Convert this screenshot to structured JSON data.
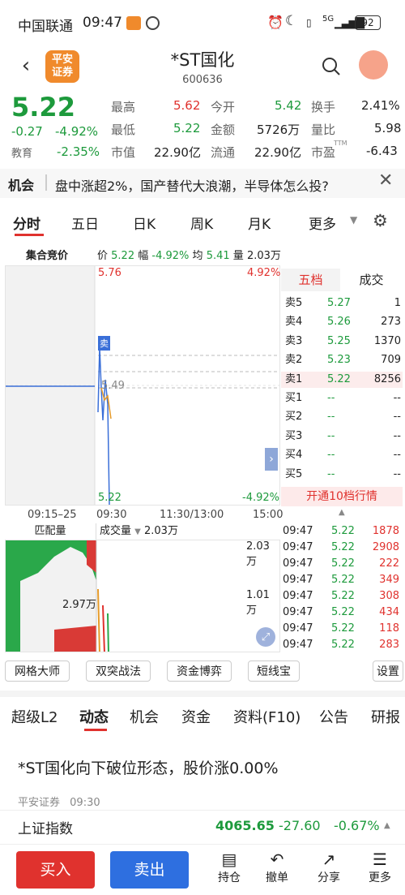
{
  "status": {
    "carrier": "中国联通",
    "time": "09:47",
    "signal": "5G",
    "battery": "92"
  },
  "nav": {
    "broker_line1": "平安",
    "broker_line2": "证券",
    "title": "*ST国化",
    "code": "600636"
  },
  "quote": {
    "price": "5.22",
    "change": "-0.27",
    "pct": "-4.92%",
    "sector": "教育",
    "sector_pct": "-2.35%",
    "high_l": "最高",
    "high": "5.62",
    "open_l": "今开",
    "open": "5.42",
    "turn_l": "换手",
    "turn": "2.41%",
    "low_l": "最低",
    "low": "5.22",
    "amt_l": "金额",
    "amt": "5726万",
    "vr_l": "量比",
    "vr": "5.98",
    "mcap_l": "市值",
    "mcap": "22.90亿",
    "float_l": "流通",
    "float": "22.90亿",
    "pe_l": "市盈",
    "pe_sup": "TTM",
    "pe": "-6.43"
  },
  "news": {
    "tag": "机会",
    "text": "盘中涨超2%，国产替代大浪潮，半导体怎么投?"
  },
  "tabs1": [
    "分时",
    "五日",
    "日K",
    "周K",
    "月K",
    "更多"
  ],
  "auction": {
    "label": "集合竞价",
    "price_l": "价",
    "price": "5.22",
    "range_l": "幅",
    "range": "-4.92%",
    "avg_l": "均",
    "avg": "5.41",
    "vol_l": "量",
    "vol": "2.03万"
  },
  "chart": {
    "top_price": "5.76",
    "top_pct": "4.92%",
    "mid": "5.49",
    "bot_price": "5.22",
    "bot_pct": "-4.92%",
    "sell_marker": "卖",
    "times": [
      "09:15–25",
      "09:30",
      "11:30/13:00",
      "15:00"
    ],
    "vol_tab_left": "匹配量",
    "vol_tab_right": "成交量",
    "vol_value": "2.03万",
    "vol_top": "2.03万",
    "vol_mid": "1.01万",
    "match_mid": "2.97万"
  },
  "order": {
    "tab_left": "五档",
    "tab_right": "成交",
    "levels": [
      [
        "卖5",
        "5.27",
        "1"
      ],
      [
        "卖4",
        "5.26",
        "273"
      ],
      [
        "卖3",
        "5.25",
        "1370"
      ],
      [
        "卖2",
        "5.23",
        "709"
      ],
      [
        "卖1",
        "5.22",
        "8256"
      ],
      [
        "买1",
        "--",
        "--"
      ],
      [
        "买2",
        "--",
        "--"
      ],
      [
        "买3",
        "--",
        "--"
      ],
      [
        "买4",
        "--",
        "--"
      ],
      [
        "买5",
        "--",
        "--"
      ]
    ],
    "open10": "开通10档行情"
  },
  "trades": [
    [
      "09:47",
      "5.22",
      "1878"
    ],
    [
      "09:47",
      "5.22",
      "2908"
    ],
    [
      "09:47",
      "5.22",
      "222"
    ],
    [
      "09:47",
      "5.22",
      "349"
    ],
    [
      "09:47",
      "5.22",
      "308"
    ],
    [
      "09:47",
      "5.22",
      "434"
    ],
    [
      "09:47",
      "5.22",
      "118"
    ],
    [
      "09:47",
      "5.22",
      "283"
    ]
  ],
  "tools": [
    "网格大师",
    "双突战法",
    "资金博弈",
    "短线宝",
    "设置"
  ],
  "tabs2": [
    "超级L2",
    "动态",
    "机会",
    "资金",
    "资料(F10)",
    "公告",
    "研报"
  ],
  "article": {
    "title": "*ST国化向下破位形态，股价涨0.00%",
    "source": "平安证券",
    "time": "09:30"
  },
  "index": {
    "name": "上证指数",
    "value": "4065.65",
    "chg": "-27.60",
    "pct": "-0.67%"
  },
  "bottom": {
    "buy": "买入",
    "sell": "卖出",
    "hold": "持仓",
    "cancel": "撤单",
    "share": "分享",
    "more": "更多"
  },
  "colors": {
    "up": "#e0322e",
    "down": "#1d9a3c",
    "accent": "#f08a2c"
  }
}
